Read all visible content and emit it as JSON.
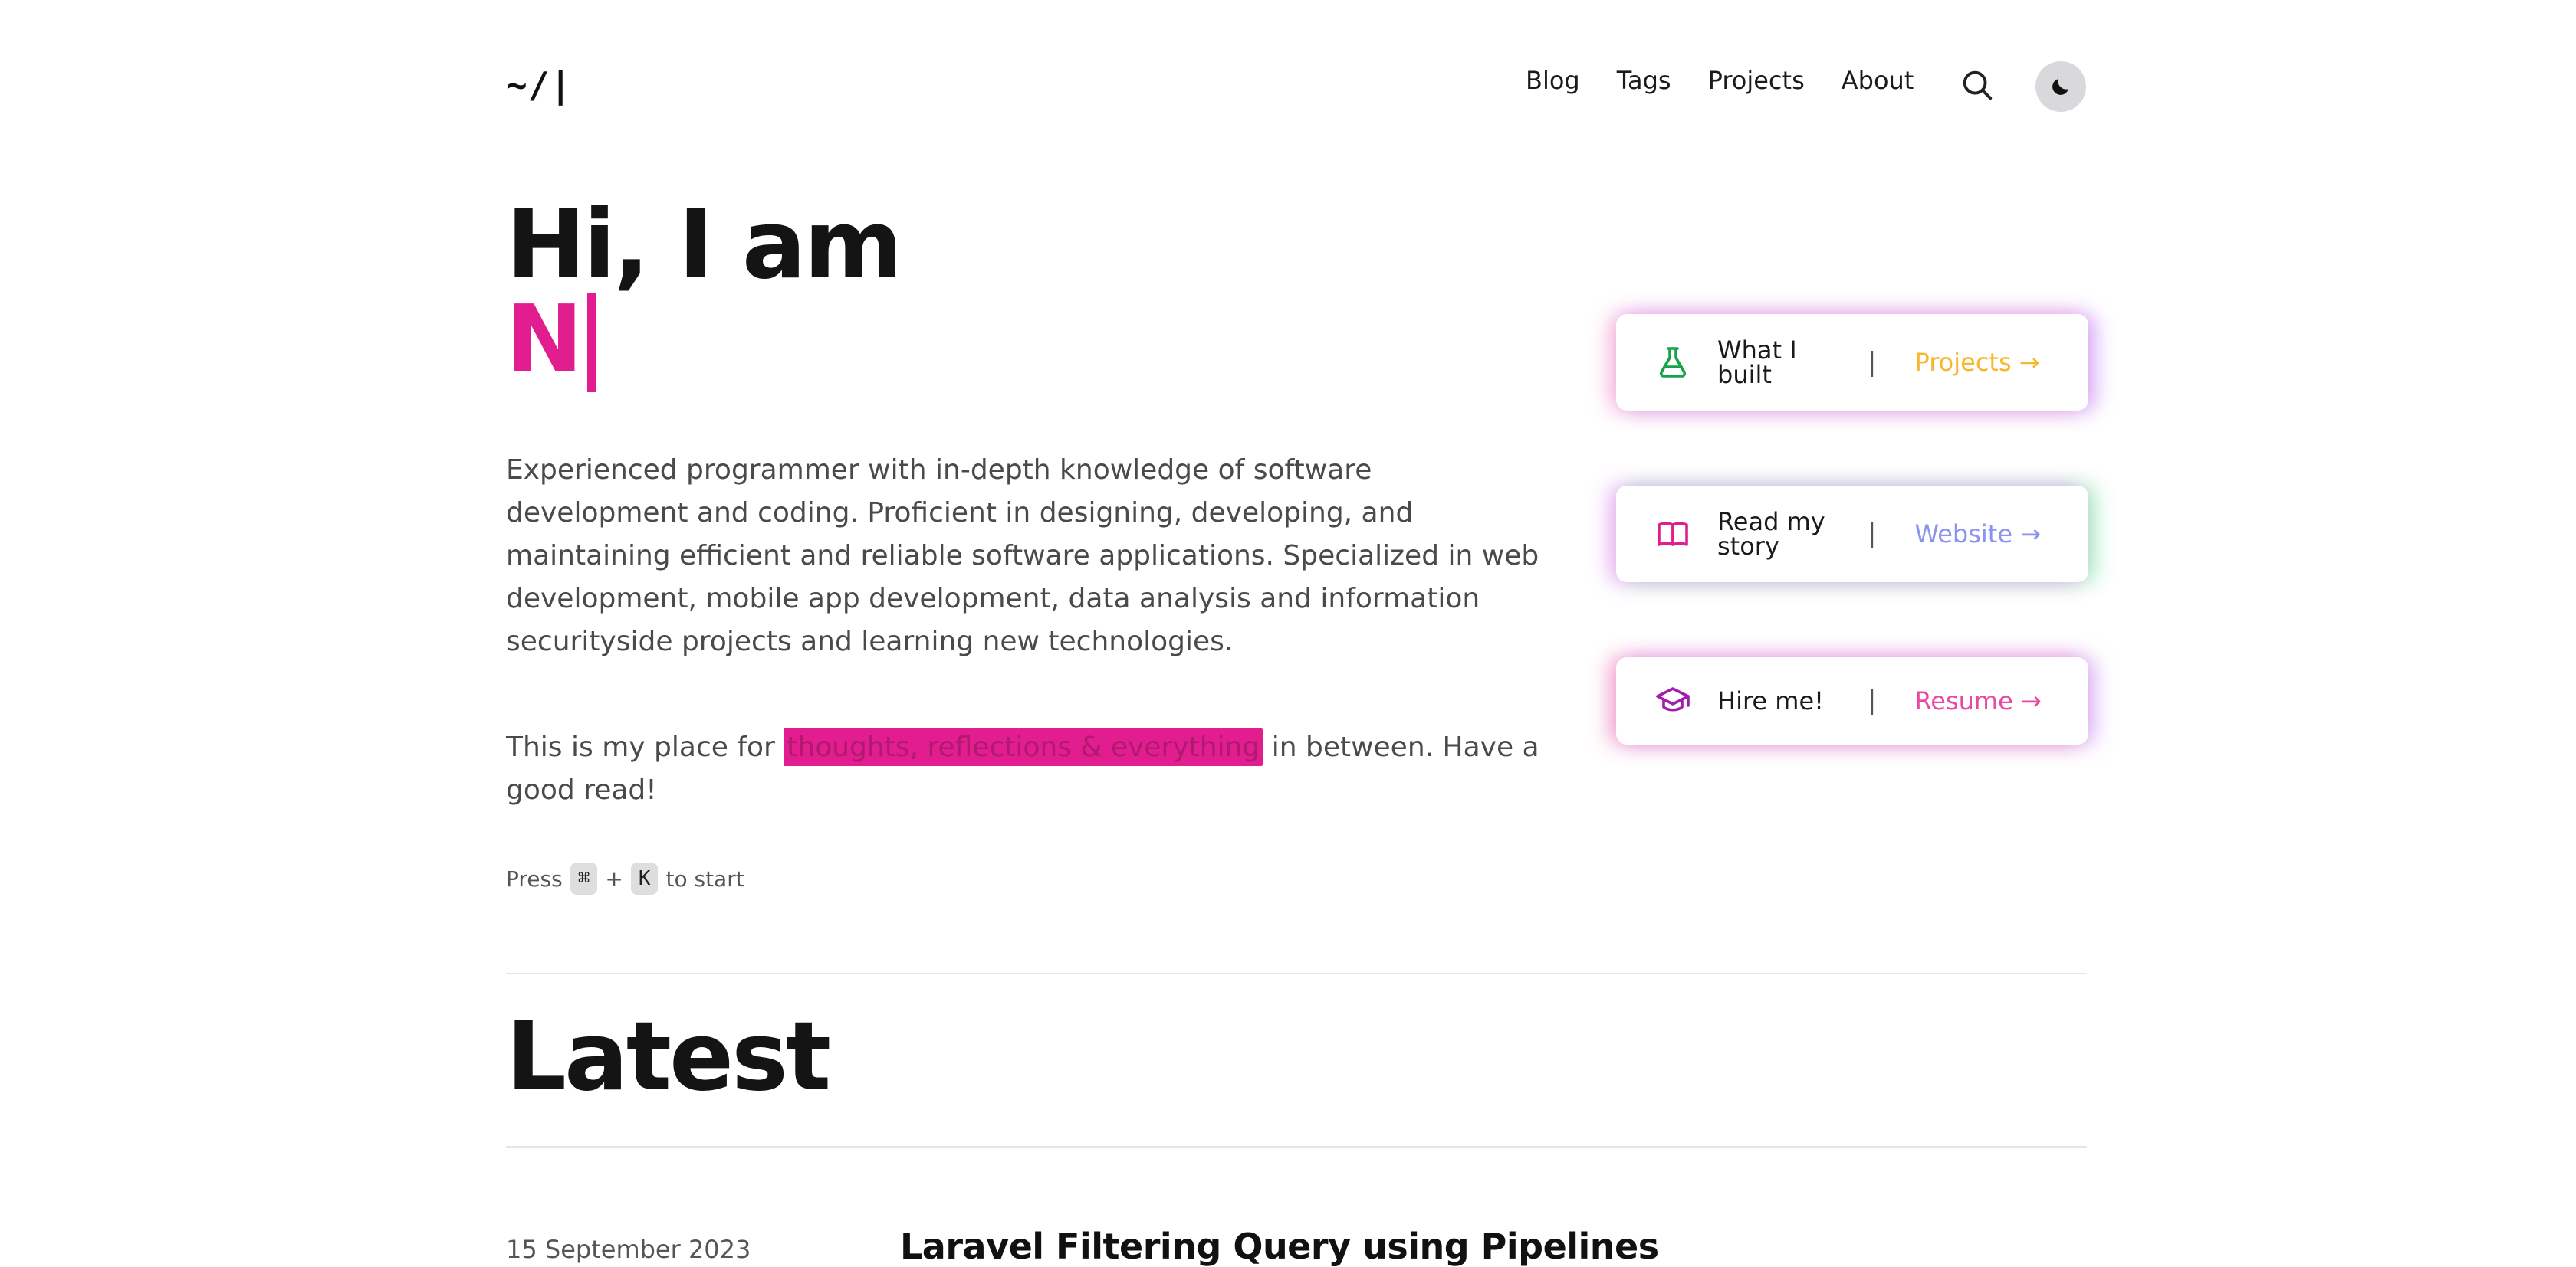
{
  "header": {
    "logo": "~/|",
    "nav": [
      "Blog",
      "Tags",
      "Projects",
      "About"
    ],
    "search_icon": "search-icon",
    "theme_icon": "moon-icon"
  },
  "hero": {
    "greeting": "Hi, I am",
    "name_typed": "N",
    "bio": "Experienced programmer with in-depth knowledge of software development and coding. Proficient in designing, developing, and maintaining efficient and reliable software applications. Specialized in web development, mobile app development, data analysis and information securityside projects and learning new technologies.",
    "tagline_before": "This is my place for",
    "tagline_highlight": "thoughts, reflections & everything",
    "tagline_after": "in between. Have a good read!",
    "shortcut_press": "Press",
    "shortcut_key1": "⌘",
    "shortcut_plus": "+",
    "shortcut_key2": "K",
    "shortcut_suffix": "to start"
  },
  "cards": [
    {
      "icon": "flask-icon",
      "label": "What I built",
      "separator": "|",
      "link": "Projects →",
      "link_color": "#f5b82e"
    },
    {
      "icon": "book-icon",
      "label": "Read my story",
      "separator": "|",
      "link": "Website →",
      "link_color": "#8b93f0"
    },
    {
      "icon": "graduation-cap-icon",
      "label": "Hire me!",
      "separator": "|",
      "link": "Resume →",
      "link_color": "#e84aa3"
    }
  ],
  "latest": {
    "title": "Latest",
    "posts": [
      {
        "date": "15 September 2023",
        "title": "Laravel Filtering Query using Pipelines"
      }
    ]
  },
  "colors": {
    "accent": "#e11d8f",
    "text": "#1a1a1a",
    "muted": "#4a4a4a"
  }
}
